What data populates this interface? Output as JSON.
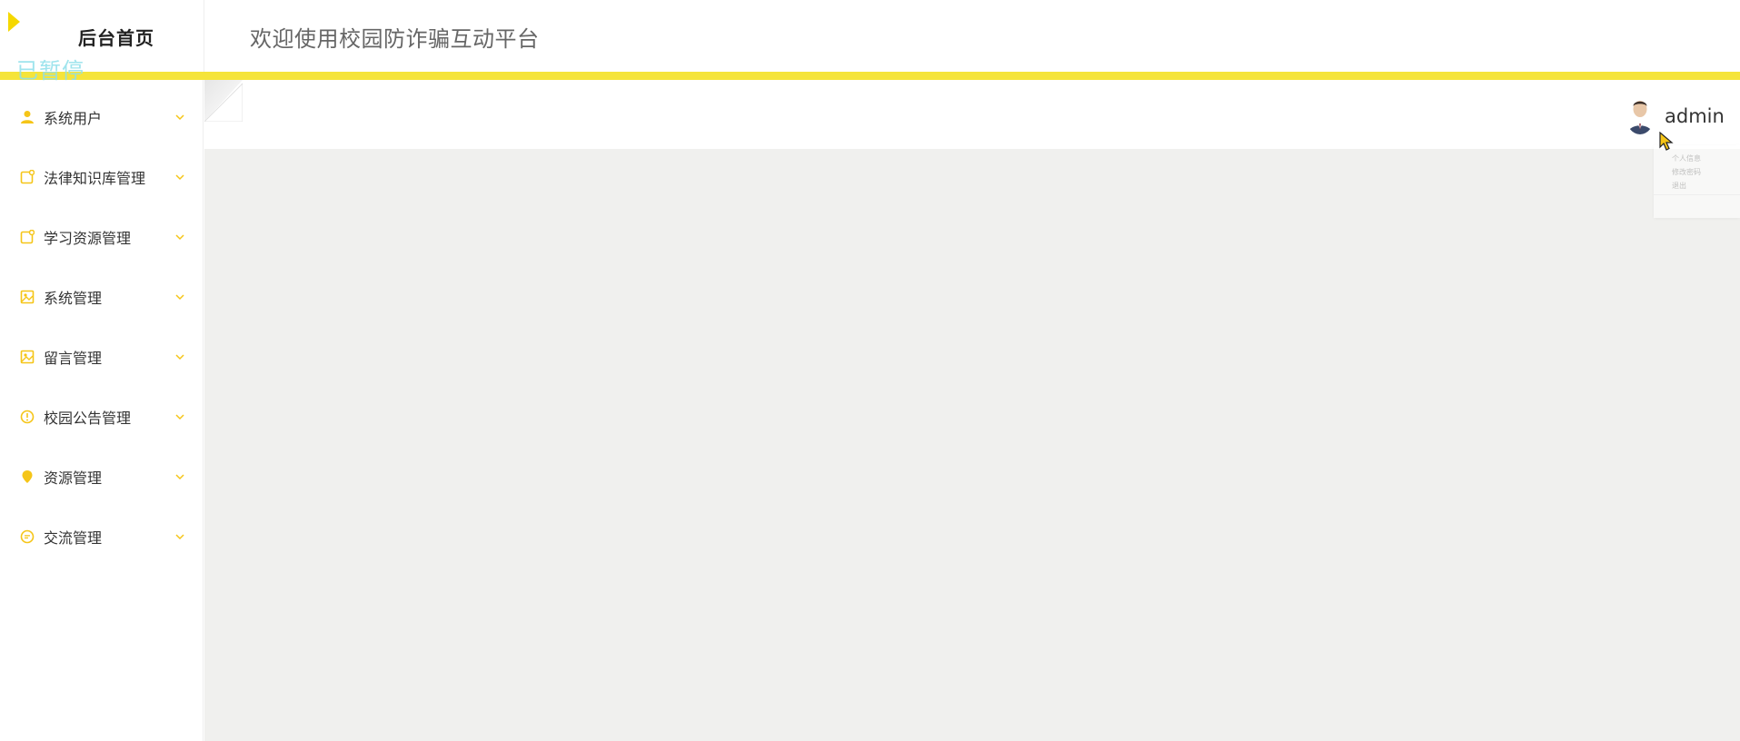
{
  "header": {
    "brand_title": "后台首页",
    "welcome": "欢迎使用校园防诈骗互动平台",
    "paused_label": "已暂停",
    "accent_color": "#f5e43a",
    "play_icon": "play-icon"
  },
  "sidebar": {
    "items": [
      {
        "label": "系统用户",
        "icon": "user-icon"
      },
      {
        "label": "法律知识库管理",
        "icon": "edit-square-icon"
      },
      {
        "label": "学习资源管理",
        "icon": "edit-square-icon"
      },
      {
        "label": "系统管理",
        "icon": "picture-icon"
      },
      {
        "label": "留言管理",
        "icon": "picture-icon"
      },
      {
        "label": "校园公告管理",
        "icon": "alert-circle-icon"
      },
      {
        "label": "资源管理",
        "icon": "location-pin-icon"
      },
      {
        "label": "交流管理",
        "icon": "chat-bubble-icon"
      }
    ],
    "icon_color": "#f5c518"
  },
  "user": {
    "name": "admin",
    "avatar_icon": "avatar",
    "dropdown": [
      "个人信息",
      "修改密码",
      "退出"
    ]
  }
}
